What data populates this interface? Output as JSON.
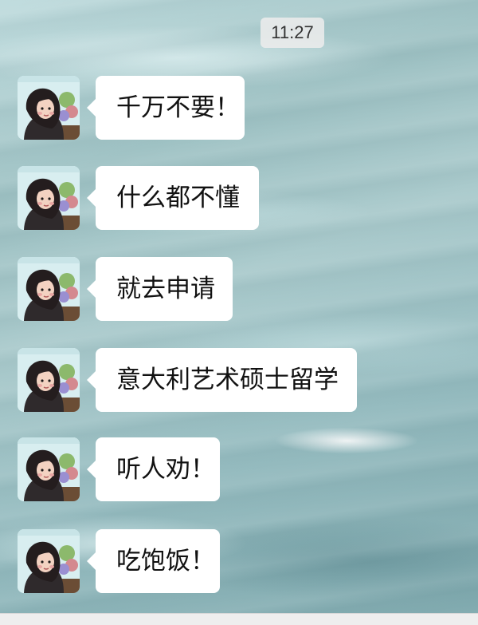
{
  "chat": {
    "timestamp": "11:27",
    "messages": [
      {
        "text": "千万不要！"
      },
      {
        "text": "什么都不懂"
      },
      {
        "text": "就去申请"
      },
      {
        "text": "意大利艺术硕士留学"
      },
      {
        "text": "听人劝！"
      },
      {
        "text": "吃饱饭！"
      }
    ]
  },
  "icons": {
    "avatar": "girl-cartoon-avatar"
  }
}
